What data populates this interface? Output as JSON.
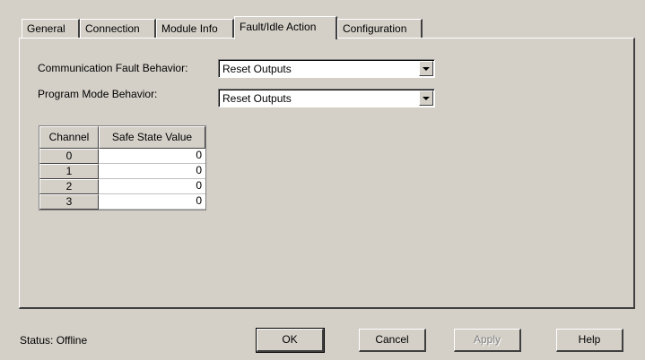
{
  "tabs": [
    {
      "label": "General"
    },
    {
      "label": "Connection"
    },
    {
      "label": "Module Info"
    },
    {
      "label": "Fault/Idle Action",
      "selected": true
    },
    {
      "label": "Configuration"
    }
  ],
  "fault_page": {
    "comm_fault_label": "Communication Fault Behavior:",
    "comm_fault_value": "Reset Outputs",
    "program_mode_label": "Program Mode Behavior:",
    "program_mode_value": "Reset Outputs",
    "table": {
      "headers": [
        "Channel",
        "Safe State Value"
      ],
      "rows": [
        {
          "channel": "0",
          "value": "0"
        },
        {
          "channel": "1",
          "value": "0"
        },
        {
          "channel": "2",
          "value": "0"
        },
        {
          "channel": "3",
          "value": "0"
        }
      ]
    }
  },
  "status": "Status:  Offline",
  "buttons": {
    "ok": "OK",
    "cancel": "Cancel",
    "apply": "Apply",
    "help": "Help"
  }
}
